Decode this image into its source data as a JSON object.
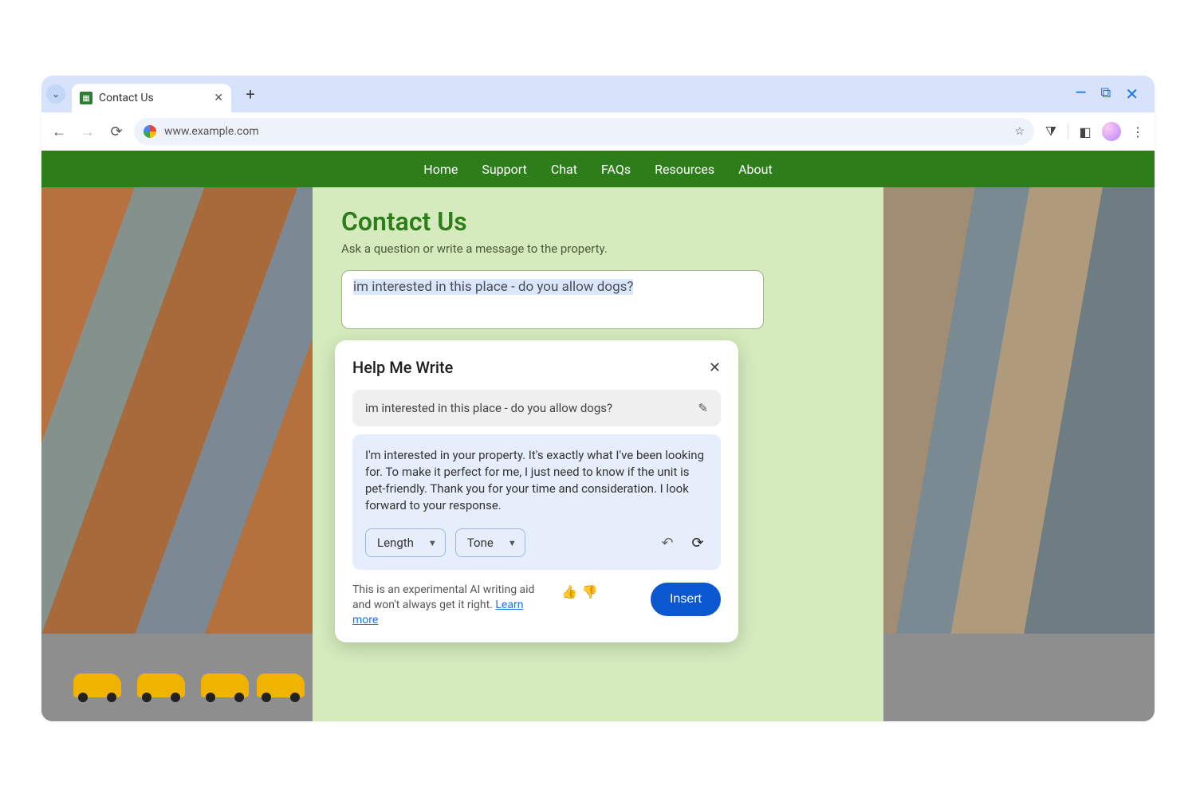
{
  "browser": {
    "tab_title": "Contact Us",
    "url": "www.example.com"
  },
  "site_nav": [
    "Home",
    "Support",
    "Chat",
    "FAQs",
    "Resources",
    "About"
  ],
  "page": {
    "heading": "Contact Us",
    "subheading": "Ask a question or write a message to the property.",
    "message_text": "im interested in this place - do you allow dogs?"
  },
  "hmw": {
    "title": "Help Me Write",
    "prompt": "im interested in this place - do you allow dogs?",
    "result": "I'm interested in your property. It's exactly what I've been looking for. To make it perfect for me, I just need to know if the unit is pet-friendly. Thank you for your time and consideration. I look forward to your response.",
    "chip_length": "Length",
    "chip_tone": "Tone",
    "disclaimer_a": "This is an experimental AI writing aid and won't always get it right. ",
    "learn_more": "Learn more",
    "insert_label": "Insert"
  }
}
